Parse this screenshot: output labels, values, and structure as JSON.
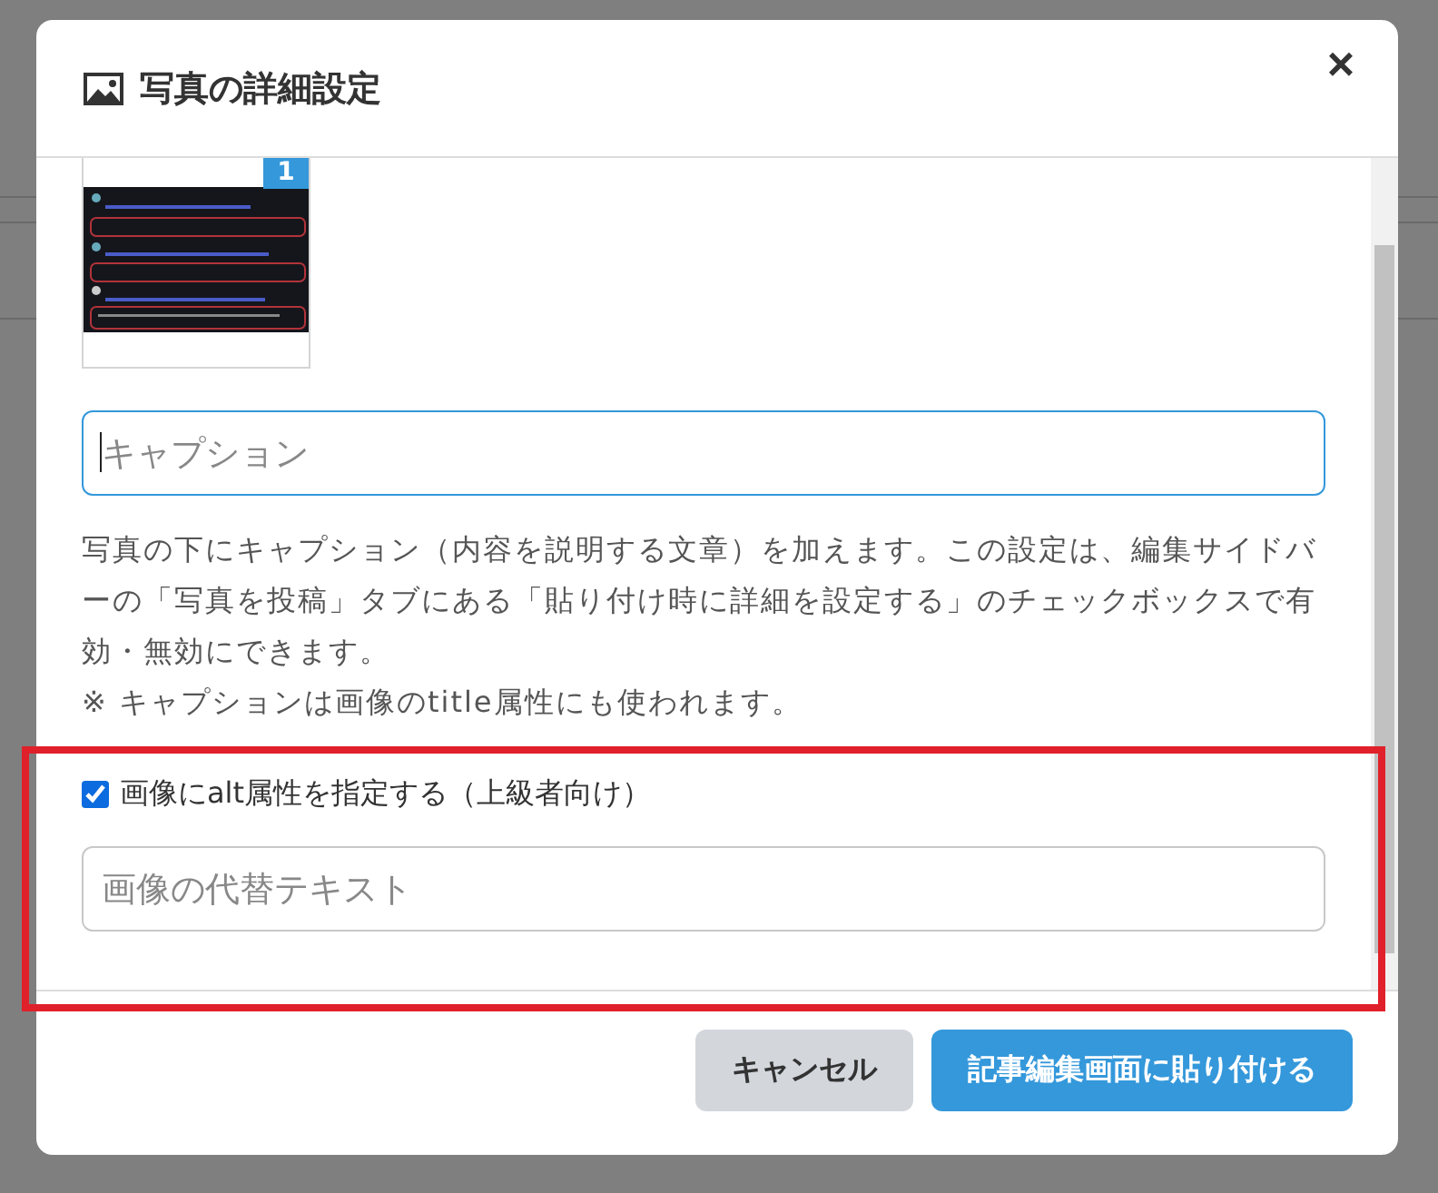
{
  "dialog": {
    "title": "写真の詳細設定",
    "close": "×"
  },
  "photo": {
    "badge": "1"
  },
  "caption": {
    "placeholder": "キャプション",
    "focused": true
  },
  "help": [
    "写真の下にキャプション（内容を説明する文章）を加えます。この設定は、編集サイドバーの「写真を投稿」タブにある「貼り付け時に詳細を設定する」のチェックボックスで有効・無効にできます。",
    "※ キャプションは画像のtitle属性にも使われます。"
  ],
  "alt_option": {
    "label": "画像にalt属性を指定する（上級者向け）",
    "checked": true
  },
  "alt_text": {
    "placeholder": "画像の代替テキスト"
  },
  "buttons": [
    {
      "label": "キャンセル",
      "kind": "secondary"
    },
    {
      "label": "記事編集画面に貼り付ける",
      "kind": "primary"
    }
  ]
}
